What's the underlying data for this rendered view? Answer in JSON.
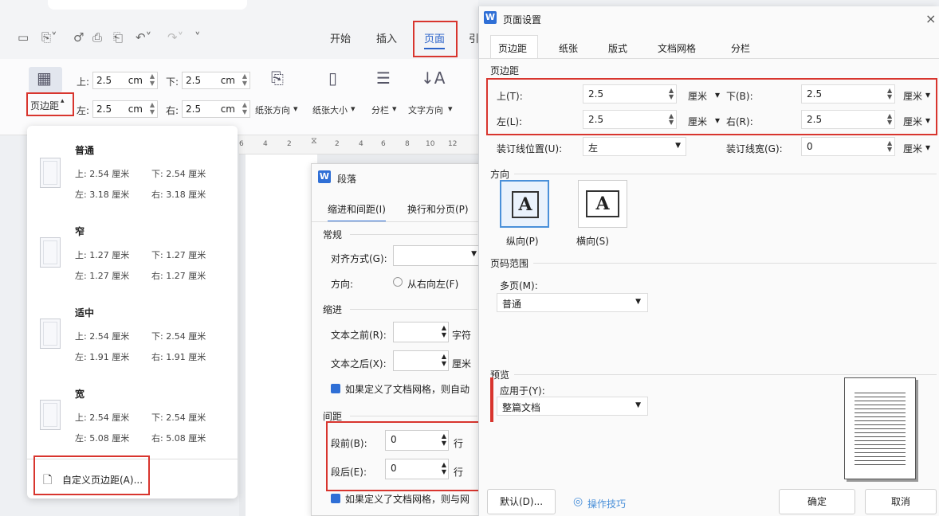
{
  "ribbon": {
    "tabs": [
      "开始",
      "插入",
      "页面",
      "引"
    ],
    "margin_button_label": "页边距",
    "top_label": "上:",
    "top_value": "2.5",
    "top_unit": "cm",
    "bottom_label": "下:",
    "bottom_value": "2.5",
    "bottom_unit": "cm",
    "left_label": "左:",
    "left_value": "2.5",
    "left_unit": "cm",
    "right_label": "右:",
    "right_value": "2.5",
    "right_unit": "cm",
    "orientation_label": "纸张方向",
    "size_label": "纸张大小",
    "columns_label": "分栏",
    "text_dir_label": "文字方向"
  },
  "ruler": {
    "numbers": [
      "6",
      "4",
      "2",
      "2",
      "4",
      "6",
      "8",
      "10",
      "12"
    ]
  },
  "margin_menu": {
    "presets": [
      {
        "name": "普通",
        "top": "上: 2.54 厘米",
        "bottom": "下: 2.54 厘米",
        "left": "左: 3.18 厘米",
        "right": "右: 3.18 厘米"
      },
      {
        "name": "窄",
        "top": "上: 1.27 厘米",
        "bottom": "下: 1.27 厘米",
        "left": "左: 1.27 厘米",
        "right": "右: 1.27 厘米"
      },
      {
        "name": "适中",
        "top": "上: 2.54 厘米",
        "bottom": "下: 2.54 厘米",
        "left": "左: 1.91 厘米",
        "right": "右: 1.91 厘米"
      },
      {
        "name": "宽",
        "top": "上: 2.54 厘米",
        "bottom": "下: 2.54 厘米",
        "left": "左: 5.08 厘米",
        "right": "右: 5.08 厘米"
      }
    ],
    "custom_label": "自定义页边距(A)..."
  },
  "paragraph_dialog": {
    "title": "段落",
    "tab1": "缩进和间距(I)",
    "tab2": "换行和分页(P)",
    "general": "常规",
    "align_label": "对齐方式(G):",
    "direction_label": "方向:",
    "rtl_label": "从右向左(F)",
    "indent": "缩进",
    "before_text": "文本之前(R):",
    "before_unit": "字符",
    "after_text": "文本之后(X):",
    "after_unit": "厘米",
    "grid_note": "如果定义了文档网格，则自动",
    "spacing": "间距",
    "before_spacing_label": "段前(B):",
    "before_spacing_value": "0",
    "after_spacing_label": "段后(E):",
    "after_spacing_value": "0",
    "line_unit": "行",
    "grid_note2": "如果定义了文档网格，则与网"
  },
  "page_setup": {
    "title": "页面设置",
    "close": "×",
    "tabs": [
      "页边距",
      "纸张",
      "版式",
      "文档网格",
      "分栏"
    ],
    "margins_section": "页边距",
    "top_label": "上(T):",
    "top_value": "2.5",
    "bottom_label": "下(B):",
    "bottom_value": "2.5",
    "left_label": "左(L):",
    "left_value": "2.5",
    "right_label": "右(R):",
    "right_value": "2.5",
    "unit": "厘米",
    "gutter_pos_label": "装订线位置(U):",
    "gutter_pos_value": "左",
    "gutter_width_label": "装订线宽(G):",
    "gutter_width_value": "0",
    "orientation_section": "方向",
    "portrait_label": "纵向(P)",
    "landscape_label": "横向(S)",
    "page_range_section": "页码范围",
    "multi_page_label": "多页(M):",
    "multi_page_value": "普通",
    "preview_section": "预览",
    "apply_label": "应用于(Y):",
    "apply_value": "整篇文档",
    "default_button": "默认(D)...",
    "tips_label": "操作技巧",
    "ok_button": "确定",
    "cancel_button": "取消"
  }
}
